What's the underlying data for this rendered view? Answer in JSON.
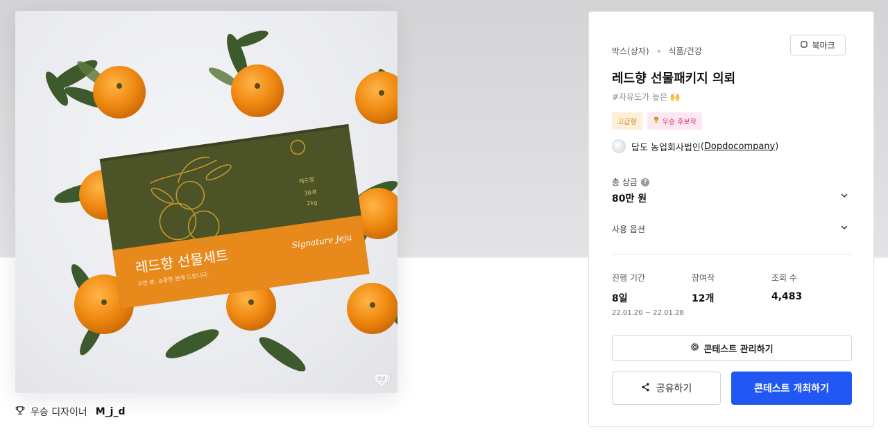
{
  "image": {
    "box_title": "레드향 선물세트",
    "box_subtitle": "귀한 분, 소중한 분께 드립니다.",
    "box_label": "레드향",
    "box_count": "30개",
    "box_weight": "2kg",
    "box_script": "Signature Jeju",
    "likes": "20"
  },
  "winner": {
    "prefix": "우승 디자이너",
    "name": "M_j_d"
  },
  "panel": {
    "breadcrumb": [
      "박스(상자)",
      "식품/건강"
    ],
    "bookmark_label": "북마크",
    "title": "레드향 선물패키지 의뢰",
    "hashtag": "#자유도가 높은 🙌",
    "badges": {
      "premium": "고급형",
      "winner_candidate": "우승 후보작"
    },
    "company": {
      "name": "답도 농업회사법인",
      "handle": "Dopdocompany"
    },
    "prize": {
      "label": "총 상금",
      "value": "80만 원"
    },
    "options_label": "사용 옵션",
    "stats": {
      "period": {
        "label": "진행 기간",
        "value": "8일",
        "range": "22.01.20 ~ 22.01.28"
      },
      "entries": {
        "label": "참여작",
        "value": "12개"
      },
      "views": {
        "label": "조회 수",
        "value": "4,483"
      }
    },
    "manage_label": "콘테스트 관리하기",
    "share_label": "공유하기",
    "host_label": "콘테스트 개최하기"
  },
  "colors": {
    "accent": "#2157f2",
    "box_green": "#4b5327",
    "box_orange": "#e8891c",
    "premium_badge": "#d6861c",
    "winner_badge": "#cf2f79"
  },
  "icons": [
    "heart-icon",
    "trophy-icon",
    "bookmark-icon",
    "help-icon",
    "chevron-down-icon",
    "gear-icon",
    "share-icon"
  ]
}
